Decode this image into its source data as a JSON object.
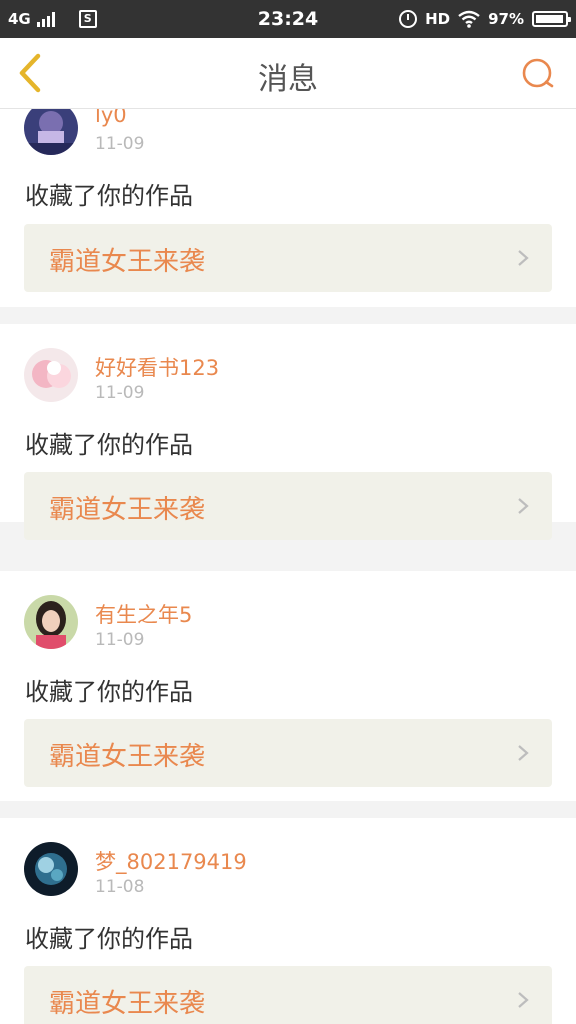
{
  "status_bar": {
    "network": "4G",
    "time": "23:24",
    "hd": "HD",
    "battery": "97%"
  },
  "header": {
    "title": "消息",
    "back_icon": "chevron-left-icon",
    "search_icon": "search-icon"
  },
  "colors": {
    "accent": "#e9884e",
    "back_arrow": "#e5b52b",
    "link_bg": "#f1f1e9"
  },
  "notifications": [
    {
      "username": "ly0",
      "date": "11-09",
      "action": "收藏了你的作品",
      "work_title": "霸道女王来袭"
    },
    {
      "username": "好好看书123",
      "date": "11-09",
      "action": "收藏了你的作品",
      "work_title": "霸道女王来袭"
    },
    {
      "username": "有生之年5",
      "date": "11-09",
      "action": "收藏了你的作品",
      "work_title": "霸道女王来袭"
    },
    {
      "username": "梦_802179419",
      "date": "11-08",
      "action": "收藏了你的作品",
      "work_title": "霸道女王来袭"
    }
  ]
}
